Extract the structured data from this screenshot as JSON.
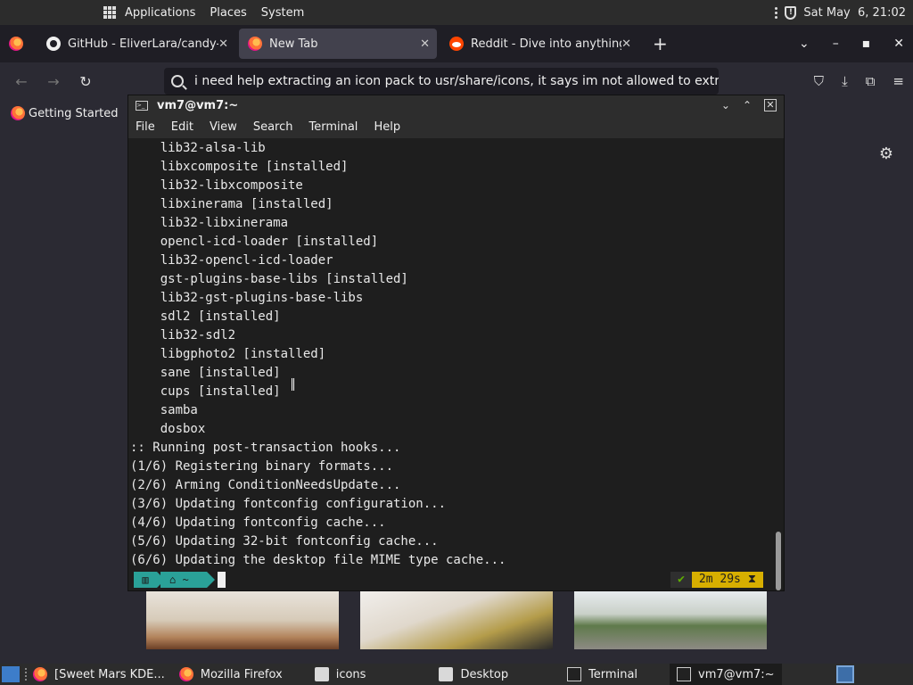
{
  "top_panel": {
    "menus": [
      "Applications",
      "Places",
      "System"
    ],
    "clock": "Sat May  6, 21:02"
  },
  "browser": {
    "tabs": [
      {
        "label": "GitHub - EliverLara/candy-i",
        "icon": "github-icon",
        "active": false
      },
      {
        "label": "New Tab",
        "icon": "firefox-icon",
        "active": true
      },
      {
        "label": "Reddit - Dive into anything",
        "icon": "reddit-icon",
        "active": false
      }
    ],
    "url_text": "i need help extracting an icon pack to usr/share/icons, it says im not allowed to extract to",
    "bookmarks": [
      "Getting Started"
    ]
  },
  "terminal": {
    "title": "vm7@vm7:~",
    "menu": [
      "File",
      "Edit",
      "View",
      "Search",
      "Terminal",
      "Help"
    ],
    "lines": [
      "    lib32-alsa-lib",
      "    libxcomposite [installed]",
      "    lib32-libxcomposite",
      "    libxinerama [installed]",
      "    lib32-libxinerama",
      "    opencl-icd-loader [installed]",
      "    lib32-opencl-icd-loader",
      "    gst-plugins-base-libs [installed]",
      "    lib32-gst-plugins-base-libs",
      "    sdl2 [installed]",
      "    lib32-sdl2",
      "    libgphoto2 [installed]",
      "    sane [installed]",
      "    cups [installed]",
      "    samba",
      "    dosbox",
      ":: Running post-transaction hooks...",
      "(1/6) Registering binary formats...",
      "(2/6) Arming ConditionNeedsUpdate...",
      "(3/6) Updating fontconfig configuration...",
      "(4/6) Updating fontconfig cache...",
      "(5/6) Updating 32-bit fontconfig cache...",
      "(6/6) Updating the desktop file MIME type cache..."
    ],
    "prompt": {
      "dir": "~",
      "ok_mark": "✔",
      "duration": "2m 29s",
      "accent_color": "#2aa198",
      "duration_color": "#d7af00"
    }
  },
  "taskbar": {
    "tasks": [
      {
        "label": "[Sweet Mars KDE...",
        "icon": "firefox-icon"
      },
      {
        "label": "Mozilla Firefox",
        "icon": "firefox-icon"
      },
      {
        "label": "icons",
        "icon": "folder-icon"
      },
      {
        "label": "Desktop",
        "icon": "folder-icon"
      },
      {
        "label": "Terminal",
        "icon": "terminal-icon"
      },
      {
        "label": "vm7@vm7:~",
        "icon": "terminal-icon"
      }
    ]
  }
}
